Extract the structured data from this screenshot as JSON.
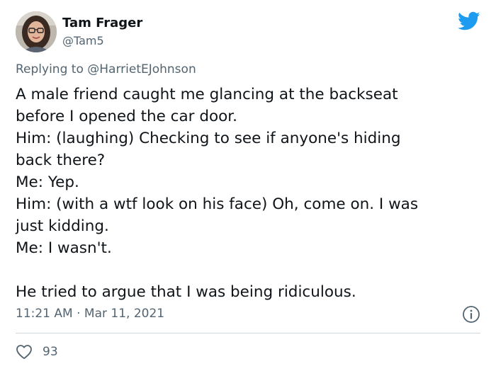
{
  "author": {
    "display_name": "Tam Frager",
    "handle": "@Tam5",
    "avatar_icon": "profile-photo"
  },
  "brand": {
    "icon": "twitter-bird-icon",
    "color": "#1d9bf0"
  },
  "reply": {
    "prefix": "Replying to",
    "mention": "@HarrietEJohnson"
  },
  "tweet": {
    "lines": [
      "A male friend caught me glancing at the backseat",
      "before I opened the car door.",
      "Him: (laughing) Checking to see if anyone's hiding",
      "back there?",
      "Me: Yep.",
      "Him: (with a wtf look on his face) Oh, come on. I was",
      "just kidding.",
      "Me: I wasn't.",
      "",
      "He tried to argue that I was being ridiculous."
    ]
  },
  "meta": {
    "time": "11:21 AM",
    "separator": "·",
    "date": "Mar 11, 2021"
  },
  "actions": {
    "like_count": "93",
    "like_icon": "heart-icon",
    "info_icon": "info-icon"
  },
  "colors": {
    "text": "#0f1419",
    "secondary": "#536471",
    "divider": "#cfd9de"
  }
}
